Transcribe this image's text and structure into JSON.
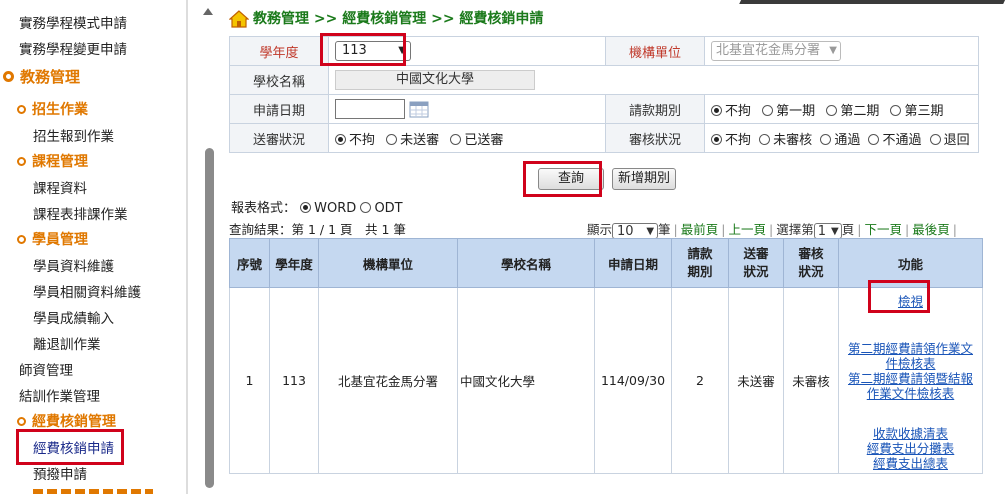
{
  "sidebar": {
    "items": [
      {
        "label": "實務學程模式申請",
        "kind": "link"
      },
      {
        "label": "實務學程變更申請",
        "kind": "link"
      },
      {
        "label": "教務管理",
        "kind": "group"
      },
      {
        "label": "招生作業",
        "kind": "sub"
      },
      {
        "label": "招生報到作業",
        "kind": "link"
      },
      {
        "label": "課程管理",
        "kind": "sub"
      },
      {
        "label": "課程資料",
        "kind": "link"
      },
      {
        "label": "課程表排課作業",
        "kind": "link"
      },
      {
        "label": "學員管理",
        "kind": "sub"
      },
      {
        "label": "學員資料維護",
        "kind": "link"
      },
      {
        "label": "學員相關資料維護",
        "kind": "link"
      },
      {
        "label": "學員成績輸入",
        "kind": "link"
      },
      {
        "label": "離退訓作業",
        "kind": "link"
      },
      {
        "label": "師資管理",
        "kind": "link"
      },
      {
        "label": "結訓作業管理",
        "kind": "link"
      },
      {
        "label": "經費核銷管理",
        "kind": "sub"
      },
      {
        "label": "經費核銷申請",
        "kind": "link"
      },
      {
        "label": "預撥申請",
        "kind": "link"
      }
    ]
  },
  "breadcrumb": "教務管理 >> 經費核銷管理 >> 經費核銷申請",
  "form": {
    "year_label": "學年度",
    "year_value": "113",
    "org_label": "機構單位",
    "org_value": "北基宜花金馬分署",
    "school_label": "學校名稱",
    "school_value": "中國文化大學",
    "date_label": "申請日期",
    "date_value": "",
    "period_label": "請款期別",
    "period_options": [
      "不拘",
      "第一期",
      "第二期",
      "第三期"
    ],
    "period_selected": "不拘",
    "send_label": "送審狀況",
    "send_options": [
      "不拘",
      "未送審",
      "已送審"
    ],
    "send_selected": "不拘",
    "review_label": "審核狀況",
    "review_options": [
      "不拘",
      "未審核",
      "通過",
      "不通過",
      "退回"
    ],
    "review_selected": "不拘"
  },
  "buttons": {
    "query": "查詢",
    "add_period": "新增期別"
  },
  "report": {
    "label": "報表格式：",
    "options": [
      "WORD",
      "ODT"
    ],
    "selected": "WORD"
  },
  "result_info": "查詢結果：第 1 / 1 頁　共 1 筆",
  "pager": {
    "show_label": "顯示",
    "page_size": "10",
    "per_label": "筆",
    "first": "最前頁",
    "prev": "上一頁",
    "choose_label": "選擇第",
    "page_no": "1",
    "page_suffix": "頁",
    "next": "下一頁",
    "last": "最後頁"
  },
  "table": {
    "headers": [
      "序號",
      "學年度",
      "機構單位",
      "學校名稱",
      "申請日期",
      "請款期別",
      "送審狀況",
      "審核狀況",
      "功能"
    ],
    "rows": [
      {
        "no": "1",
        "year": "113",
        "org": "北基宜花金馬分署",
        "school": "中國文化大學",
        "date": "114/09/30",
        "period": "2",
        "send": "未送審",
        "review": "未審核",
        "actions": {
          "view": "檢視",
          "check1": "第二期經費請領作業文件檢核表",
          "check2": "第二期經費請領暨結報作業文件檢核表",
          "receipt": "收款收據清表",
          "split": "經費支出分攤表",
          "summary": "經費支出總表"
        }
      }
    ]
  },
  "colors": {
    "accent_orange": "#e07800",
    "breadcrumb_green": "#1b7a1b",
    "highlight_red": "#d0021b",
    "header_blue": "#c5d8f0"
  }
}
